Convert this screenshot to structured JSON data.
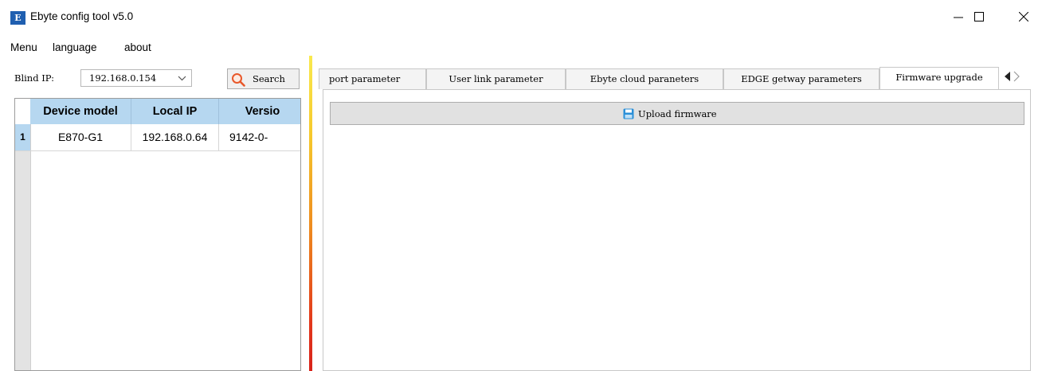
{
  "window": {
    "title": "Ebyte config tool v5.0",
    "icon_text": "E"
  },
  "menu": [
    "Menu",
    "language",
    "about"
  ],
  "left": {
    "blind_ip_label": "Blind IP:",
    "blind_ip_value": "192.168.0.154",
    "search_label": "Search",
    "table": {
      "headers": [
        "Device model",
        "Local IP",
        "Versio"
      ],
      "rows": [
        {
          "num": "1",
          "cells": [
            "E870-G1",
            "192.168.0.64",
            "9142-0-"
          ]
        }
      ]
    }
  },
  "tabs": {
    "items": [
      "port parameter",
      "User link parameter",
      "Ebyte cloud paraneters",
      "EDGE getway parameters",
      "Firmware upgrade"
    ],
    "active": "Firmware upgrade"
  },
  "content": {
    "upload_label": "Upload firmware"
  },
  "icons": [
    "app-icon",
    "minimize-icon",
    "maximize-icon",
    "close-icon",
    "chevron-down-icon",
    "search-icon",
    "tab-scroll-left-icon",
    "tab-scroll-right-icon",
    "save-disk-icon"
  ],
  "colors": {
    "header_blue": "#b6d7f0",
    "app_icon_blue": "#1f5fb0",
    "splitter_top": "#f9e94e",
    "splitter_bottom": "#d8231a",
    "search_icon": "#e8582a"
  }
}
